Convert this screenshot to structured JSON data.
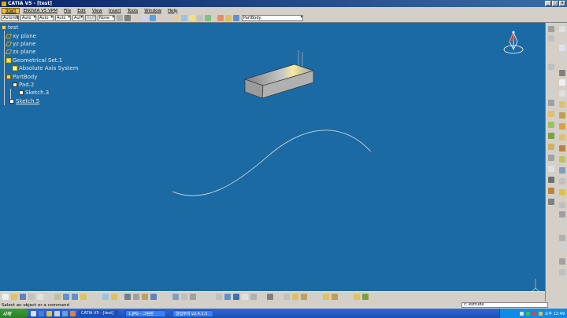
{
  "window": {
    "title": "CATIA V5 - [test]",
    "buttons": [
      "_",
      "□",
      "×"
    ]
  },
  "menu": {
    "items": [
      "Start",
      "ENOVIA V5 VPM",
      "File",
      "Edit",
      "View",
      "Insert",
      "Tools",
      "Window",
      "Help"
    ]
  },
  "toolbar": {
    "combos": [
      "Automa",
      "Auto",
      "Auto",
      "Auto",
      "Aut",
      "Aut",
      "None"
    ],
    "part_select": "PartBody"
  },
  "tree": {
    "root": "test",
    "xy": "xy plane",
    "yz": "yz plane",
    "zx": "zx plane",
    "geoset": "Geometrical Set.1",
    "axis": "Absolute Axis System",
    "partbody": "PartBody",
    "pad": "Pad.2",
    "sketch3": "Sketch.3",
    "sketch5": "Sketch.5"
  },
  "status": {
    "message": "Select an object or a command",
    "command": "c: extrude"
  },
  "taskbar": {
    "start": "시작",
    "tasks": [
      "CATIA V5 - [test]",
      "1.JPG - 그림판",
      "알집무비 v2.4.1.5"
    ],
    "clock": "오후 12:49"
  },
  "colors": {
    "viewport": "#1c6aa3",
    "accent": "#e8c050"
  }
}
